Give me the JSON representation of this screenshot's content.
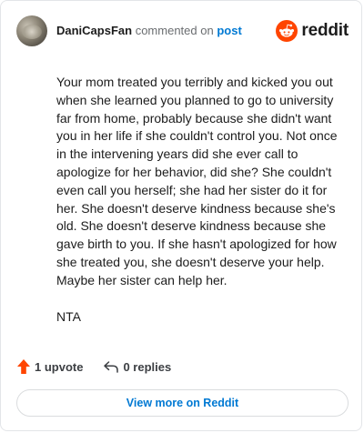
{
  "header": {
    "username": "DaniCapsFan",
    "action": "commented on",
    "post_link": "post",
    "brand": "reddit"
  },
  "comment": {
    "paragraphs": [
      "Your mom treated you terribly and kicked you out when she learned you planned to go to university far from home, probably because she didn't want you in her life if she couldn't control you. Not once in the intervening years did she ever call to apologize for her behavior, did she? She couldn't even call you herself; she had her sister do it for her. She doesn't deserve kindness because she's old. She doesn't deserve kindness because she gave birth to you. If she hasn't apologized for how she treated you, she doesn't deserve your help. Maybe her sister can help her.",
      "NTA"
    ]
  },
  "footer": {
    "upvotes": "1 upvote",
    "replies": "0 replies",
    "view_more": "View more on Reddit"
  },
  "colors": {
    "reddit_orange": "#ff4500",
    "upvote_orange": "#ff4500",
    "link_blue": "#0079d3"
  },
  "icons": {
    "brand": "reddit-snoo-icon",
    "upvote": "upvote-arrow-icon",
    "reply": "reply-arrow-icon"
  }
}
